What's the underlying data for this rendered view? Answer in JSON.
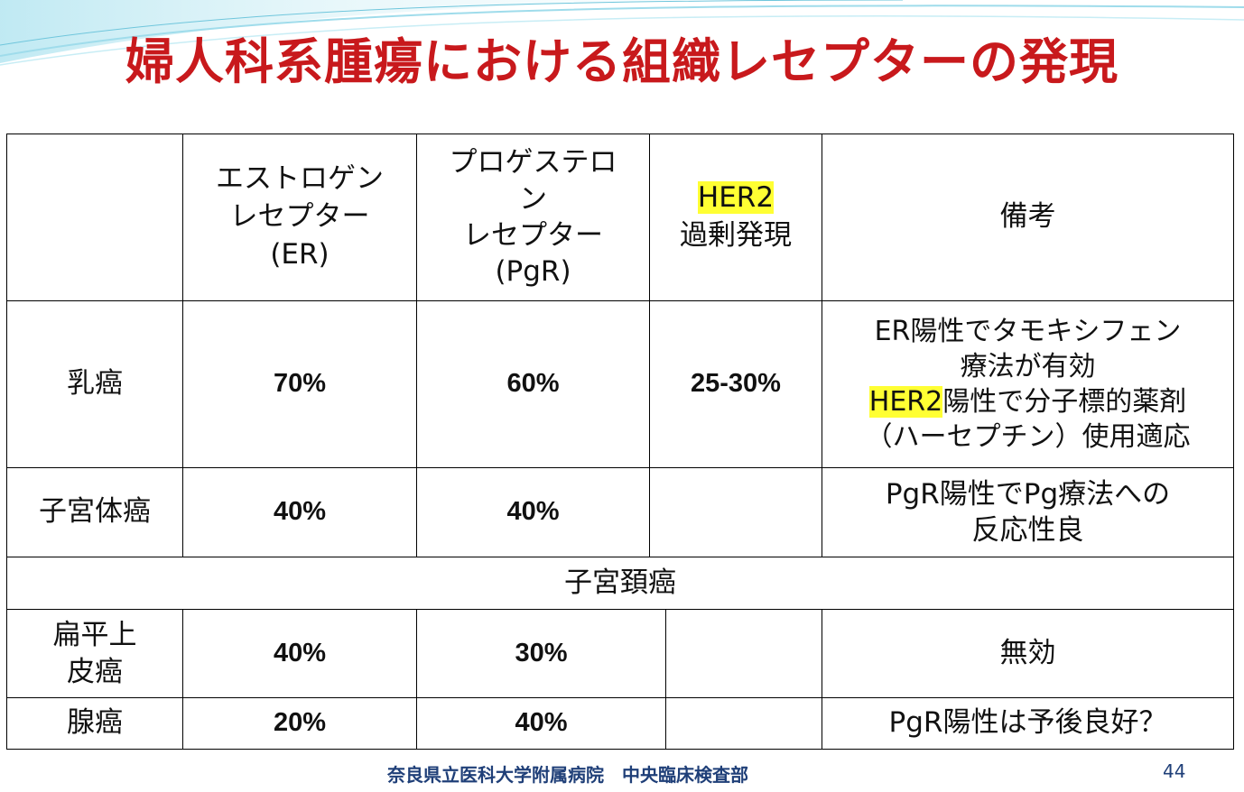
{
  "slide": {
    "title": "婦人科系腫瘍における組織レセプターの発現",
    "footer": "奈良県立医科大学附属病院　中央臨床検査部",
    "page_number": "44",
    "colors": {
      "title": "#c8191c",
      "highlight": "#ffff33",
      "footer": "#1f3f78"
    }
  },
  "table": {
    "headers": {
      "corner": "",
      "er": [
        "エストロゲン",
        "レセプター",
        "(ER)"
      ],
      "pgr": [
        "プロゲステロ",
        "ン",
        "レセプター",
        "(PgR)"
      ],
      "her2_tag": "HER2",
      "her2_text": "過剰発現",
      "notes": "備考"
    },
    "rows": {
      "breast": {
        "label": "乳癌",
        "er": "70%",
        "pgr": "60%",
        "her2": "25-30%",
        "notes_1": "ER陽性でタモキシフェン",
        "notes_2": "療法が有効",
        "notes_3_tag": "HER2",
        "notes_3_rest": "陽性で分子標的薬剤",
        "notes_4": "（ハーセプチン）使用適応"
      },
      "endometrial": {
        "label": "子宮体癌",
        "er": "40%",
        "pgr": "40%",
        "her2": "",
        "notes_1": "PgR陽性でPg療法への",
        "notes_2": "反応性良"
      },
      "cervical_header": "子宮頚癌",
      "squamous": {
        "label_1": "扁平上",
        "label_2": "皮癌",
        "er": "40%",
        "pgr": "30%",
        "her2": "",
        "notes": "無効"
      },
      "adeno": {
        "label": "腺癌",
        "er": "20%",
        "pgr": "40%",
        "her2": "",
        "notes": "PgR陽性は予後良好？"
      }
    }
  }
}
